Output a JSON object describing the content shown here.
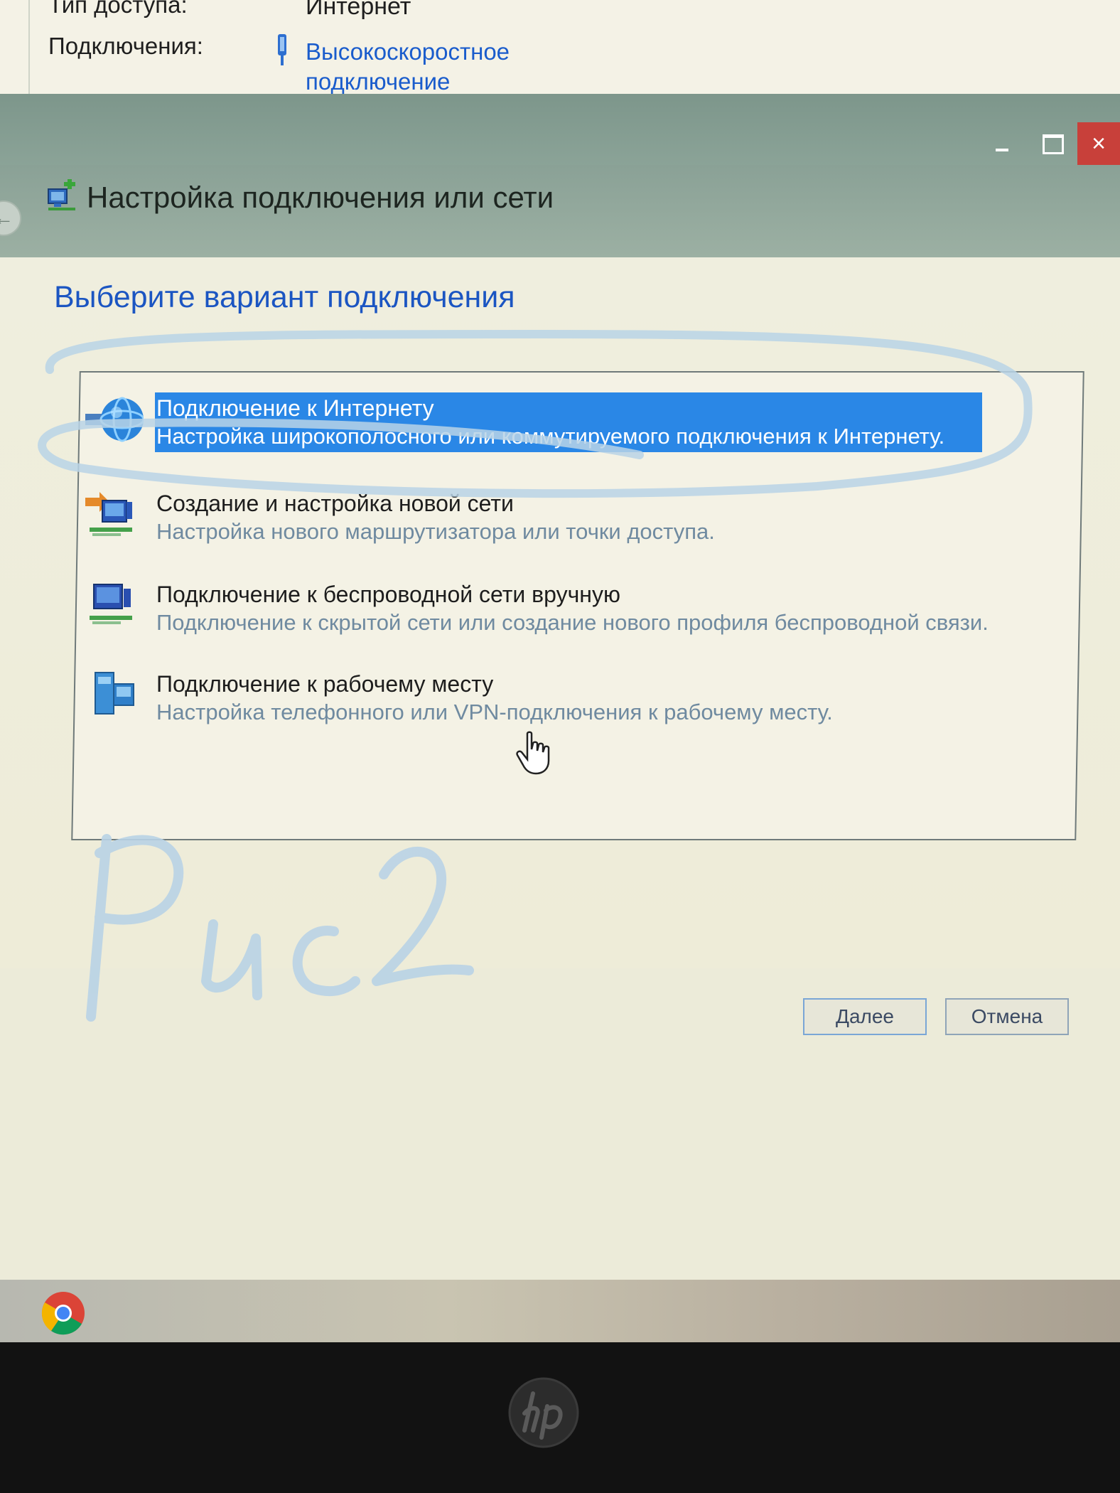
{
  "background_window": {
    "rows": [
      {
        "label": "Тип доступа:",
        "value": "Интернет"
      },
      {
        "label": "Подключения:",
        "link_line1": "Высокоскоростное",
        "link_line2": "подключение"
      }
    ]
  },
  "dialog": {
    "title": "Настройка подключения или сети",
    "prompt": "Выберите вариант подключения",
    "close_glyph": "×",
    "options": [
      {
        "title": "Подключение к Интернету",
        "desc": "Настройка широкополосного или коммутируемого подключения к Интернету.",
        "icon": "globe-icon",
        "selected": true
      },
      {
        "title": "Создание и настройка новой сети",
        "desc": "Настройка нового маршрутизатора или точки доступа.",
        "icon": "new-network-icon",
        "selected": false
      },
      {
        "title": "Подключение к беспроводной сети вручную",
        "desc": "Подключение к скрытой сети или создание нового профиля беспроводной связи.",
        "icon": "wireless-network-icon",
        "selected": false
      },
      {
        "title": "Подключение к рабочему месту",
        "desc": "Настройка телефонного или VPN-подключения к рабочему месту.",
        "icon": "workplace-icon",
        "selected": false
      }
    ],
    "buttons": {
      "next": "Далее",
      "cancel": "Отмена"
    }
  },
  "annotation": {
    "handwriting": "Рис 2",
    "color": "#b9d3e6"
  },
  "colors": {
    "selection": "#2a87e6",
    "prompt": "#1b55c2",
    "link": "#1a5ccc",
    "titlebar": "#8aa196"
  }
}
